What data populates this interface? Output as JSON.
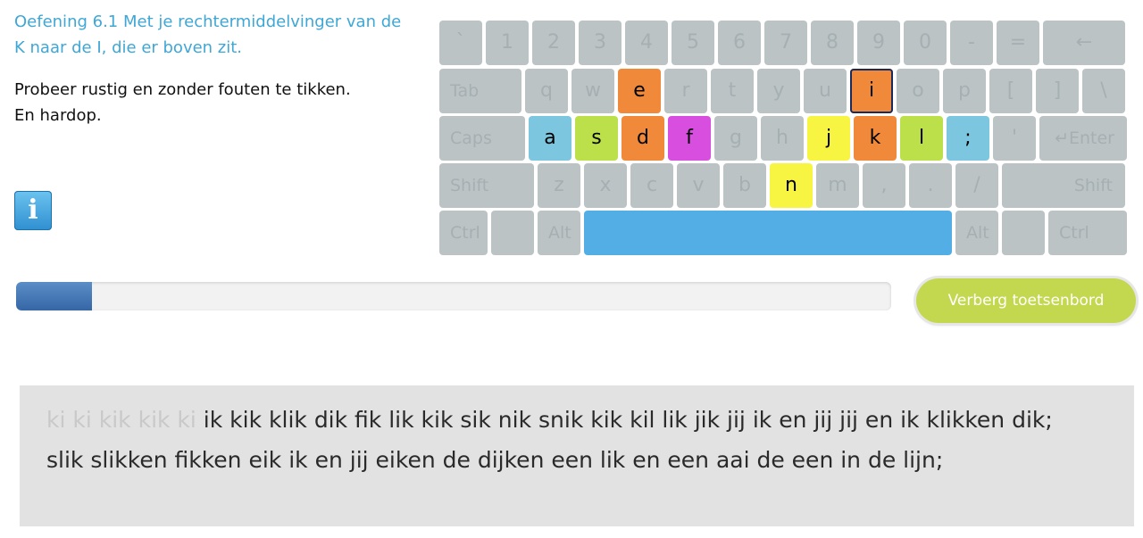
{
  "exercise": {
    "title": "Oefening 6.1 Met je rechtermiddelvinger van de K naar de I, die er boven zit.",
    "instruction_line1": "Probeer rustig en zonder fouten te tikken.",
    "instruction_line2": "En hardop.",
    "info_icon": "i"
  },
  "keyboard": {
    "colors": {
      "key_default": "#bcc3c5",
      "pinky": "#7cc7df",
      "ring": "#bce04a",
      "middle": "#f08a3a",
      "index_left": "#d84fe0",
      "index_right": "#f8f542",
      "space": "#53aee6"
    },
    "row1": [
      "`",
      "1",
      "2",
      "3",
      "4",
      "5",
      "6",
      "7",
      "8",
      "9",
      "0",
      "-",
      "=",
      "←"
    ],
    "row2": [
      "Tab",
      "q",
      "w",
      "e",
      "r",
      "t",
      "y",
      "u",
      "i",
      "o",
      "p",
      "[",
      "]",
      "\\"
    ],
    "row3": [
      "Caps",
      "a",
      "s",
      "d",
      "f",
      "g",
      "h",
      "j",
      "k",
      "l",
      ";",
      "'",
      "↵Enter"
    ],
    "row4": [
      "Shift",
      "z",
      "x",
      "c",
      "v",
      "b",
      "n",
      "m",
      ",",
      ".",
      "/",
      "Shift"
    ],
    "row5": [
      "Ctrl",
      "",
      "Alt",
      "",
      "Alt",
      "",
      "Ctrl"
    ],
    "highlighted_keys": [
      {
        "key": "e",
        "finger": "middle"
      },
      {
        "key": "i",
        "finger": "middle",
        "selected": true
      },
      {
        "key": "a",
        "finger": "pinky"
      },
      {
        "key": "s",
        "finger": "ring"
      },
      {
        "key": "d",
        "finger": "middle"
      },
      {
        "key": "f",
        "finger": "index_left"
      },
      {
        "key": "j",
        "finger": "index_right"
      },
      {
        "key": "k",
        "finger": "middle"
      },
      {
        "key": "l",
        "finger": "ring"
      },
      {
        "key": ";",
        "finger": "pinky"
      },
      {
        "key": "n",
        "finger": "index_right"
      }
    ]
  },
  "progress": {
    "value_percent": 8.7
  },
  "toggle_keyboard_button": {
    "label": "Verberg toetsenbord"
  },
  "typing_text": {
    "typed": "ki ki kik kik ki",
    "remaining": " ik kik klik dik fik lik kik sik nik snik kik kil lik jik jij ik en jij jij en ik klikken dik; slik slikken fikken eik ik en jij eiken de dijken een lik en een aai de een in de lijn;"
  }
}
